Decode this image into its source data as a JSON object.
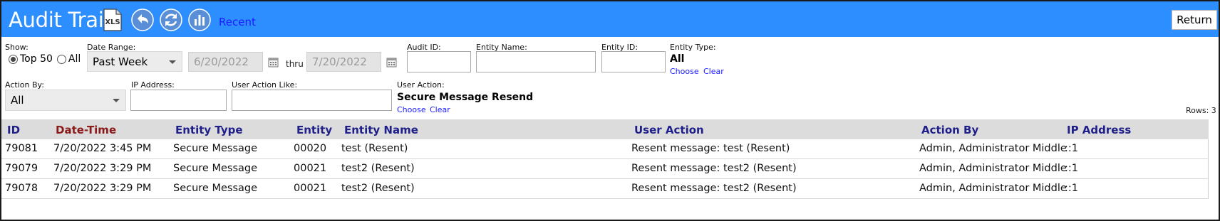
{
  "header": {
    "title": "Audit Trail",
    "xls_label": "XLS",
    "recent_link": "Recent",
    "return_button": "Return",
    "icons": [
      "xls-icon",
      "undo-icon",
      "refresh-icon",
      "chart-icon"
    ],
    "accent_color": "#2d8fff"
  },
  "filters": {
    "show_label": "Show:",
    "show_options": [
      "Top 50",
      "All"
    ],
    "show_selected": "Top 50",
    "date_range_label": "Date Range:",
    "date_range_value": "Past Week",
    "date_from": "6/20/2022",
    "thru_label": "thru",
    "date_to": "7/20/2022",
    "audit_id_label": "Audit ID:",
    "entity_name_label": "Entity Name:",
    "entity_id_label": "Entity ID:",
    "entity_type_label": "Entity Type:",
    "entity_type_value": "All",
    "choose_label": "Choose",
    "clear_label": "Clear",
    "action_by_label": "Action By:",
    "action_by_value": "All",
    "ip_address_label": "IP Address:",
    "user_action_like_label": "User Action Like:",
    "user_action_label": "User Action:",
    "user_action_value": "Secure Message Resend"
  },
  "rows_count": "Rows: 3",
  "table": {
    "columns": [
      "ID",
      "Date-Time",
      "Entity Type",
      "Entity",
      "Entity Name",
      "User Action",
      "Action By",
      "IP Address"
    ],
    "rows": [
      [
        "79081",
        "7/20/2022 3:45 PM",
        "Secure Message",
        "00020",
        "test (Resent)",
        "Resent message: test (Resent)",
        "Admin, Administrator Middle",
        "::1"
      ],
      [
        "79079",
        "7/20/2022 3:29 PM",
        "Secure Message",
        "00021",
        "test2 (Resent)",
        "Resent message: test2 (Resent)",
        "Admin, Administrator Middle",
        "::1"
      ],
      [
        "79078",
        "7/20/2022 3:29 PM",
        "Secure Message",
        "00021",
        "test2 (Resent)",
        "Resent message: test2 (Resent)",
        "Admin, Administrator Middle",
        "::1"
      ]
    ]
  }
}
